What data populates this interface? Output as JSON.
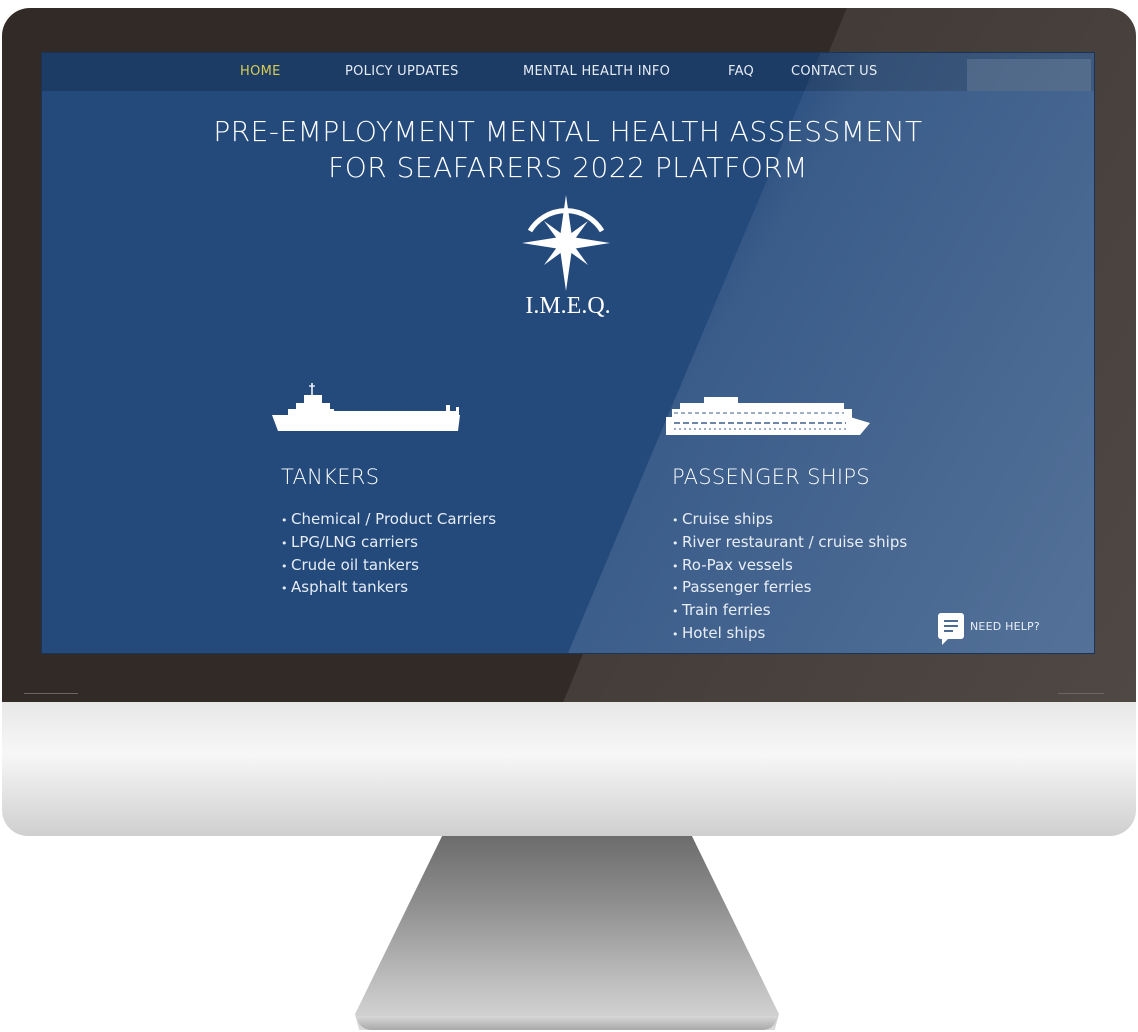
{
  "nav": {
    "items": [
      {
        "label": "HOME",
        "active": true
      },
      {
        "label": "POLICY UPDATES",
        "active": false
      },
      {
        "label": "MENTAL HEALTH INFO",
        "active": false
      },
      {
        "label": "FAQ",
        "active": false
      },
      {
        "label": "CONTACT US",
        "active": false
      }
    ]
  },
  "hero": {
    "title_line1": "PRE-EMPLOYMENT MENTAL HEALTH ASSESSMENT",
    "title_line2": "FOR SEAFARERS 2022 PLATFORM",
    "logo_text": "I.M.E.Q.",
    "logo_icon": "compass-rose-icon"
  },
  "sections": {
    "tankers": {
      "title": "TANKERS",
      "icon": "tanker-ship-icon",
      "items": [
        "Chemical / Product Carriers",
        "LPG/LNG carriers",
        "Crude oil tankers",
        "Asphalt tankers"
      ]
    },
    "passenger": {
      "title": "PASSENGER SHIPS",
      "icon": "cruise-ship-icon",
      "items": [
        "Cruise ships",
        "River restaurant / cruise ships",
        "Ro-Pax vessels",
        "Passenger ferries",
        "Train ferries",
        "Hotel ships"
      ]
    }
  },
  "help": {
    "label": "NEED HELP?",
    "icon": "chat-icon"
  },
  "colors": {
    "screen_bg": "#244a7c",
    "nav_bg": "#1c3c66",
    "nav_active": "#d6cc55",
    "bezel": "#322a26"
  }
}
